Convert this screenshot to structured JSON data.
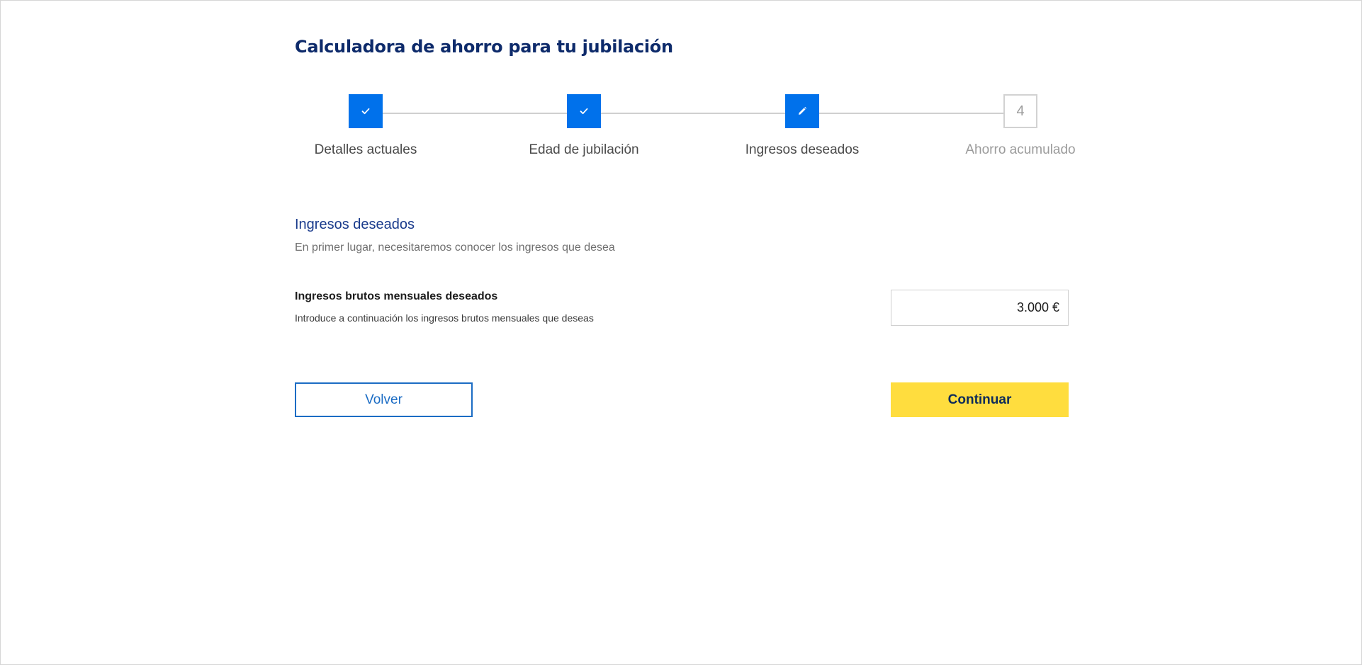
{
  "page": {
    "title": "Calculadora de ahorro para tu jubilación"
  },
  "stepper": {
    "steps": [
      {
        "label": "Detalles actuales",
        "status": "completed",
        "icon": "check-icon"
      },
      {
        "label": "Edad de jubilación",
        "status": "completed",
        "icon": "check-icon"
      },
      {
        "label": "Ingresos deseados",
        "status": "current",
        "icon": "pencil-icon"
      },
      {
        "label": "Ahorro acumulado",
        "status": "pending",
        "number": "4"
      }
    ]
  },
  "section": {
    "title": "Ingresos deseados",
    "subtitle": "En primer lugar, necesitaremos conocer los ingresos que desea"
  },
  "field": {
    "label": "Ingresos brutos mensuales deseados",
    "help": "Introduce a continuación los ingresos brutos mensuales que deseas",
    "value": "3.000 €"
  },
  "actions": {
    "back_label": "Volver",
    "continue_label": "Continuar"
  },
  "colors": {
    "primary": "#0071eb",
    "title": "#0e2b6b",
    "accent": "#ffdd3e",
    "outline": "#1b6cc4"
  }
}
